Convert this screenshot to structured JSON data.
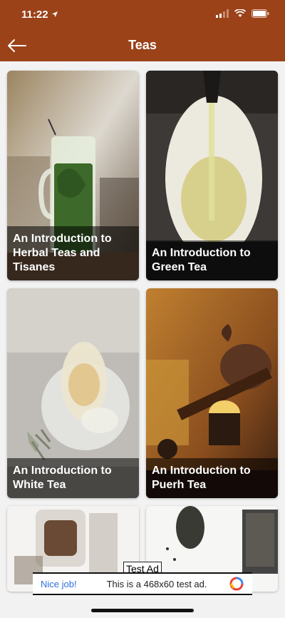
{
  "status_bar": {
    "time": "11:22"
  },
  "header": {
    "title": "Teas"
  },
  "cards": [
    {
      "caption": "An Introduction to Herbal Teas and Tisanes"
    },
    {
      "caption": "An Introduction to Green Tea"
    },
    {
      "caption": "An Introduction to White Tea"
    },
    {
      "caption": "An Introduction to Puerh Tea"
    }
  ],
  "ad": {
    "label": "Test Ad",
    "cta": "Nice job!",
    "message": "This is a 468x60 test ad."
  },
  "colors": {
    "accent": "#9b4219",
    "ad_link": "#2c6ed8"
  }
}
